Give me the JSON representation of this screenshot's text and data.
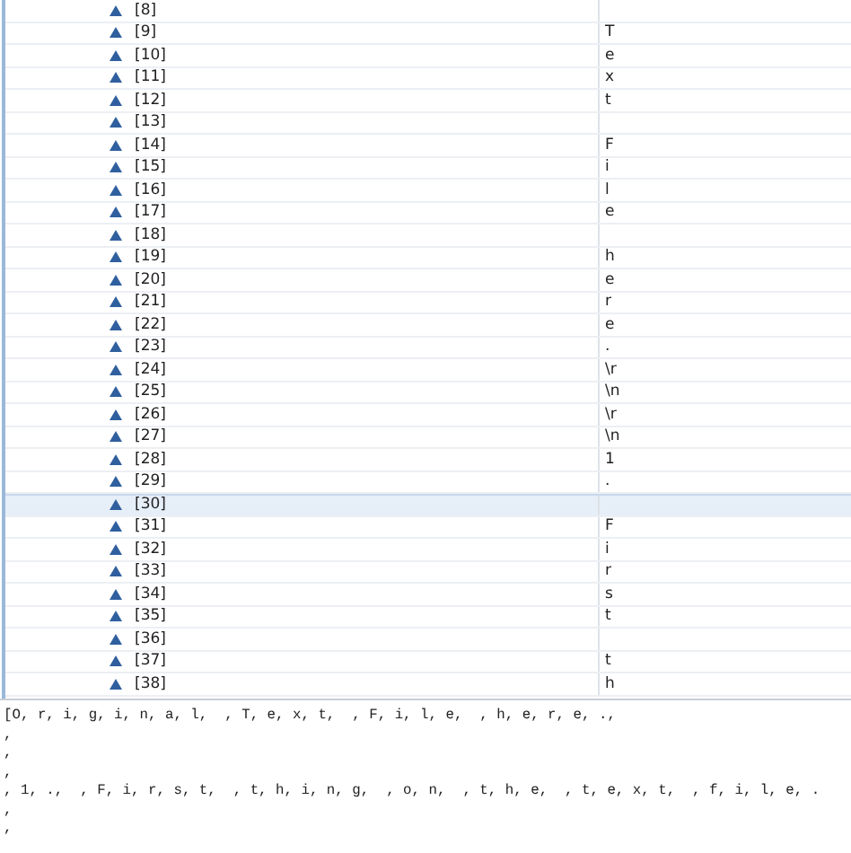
{
  "variables": [
    {
      "name": "[8]",
      "selected": false
    },
    {
      "name": "[9]",
      "value": "T",
      "selected": false
    },
    {
      "name": "[10]",
      "value": "e",
      "selected": false
    },
    {
      "name": "[11]",
      "value": "x",
      "selected": false
    },
    {
      "name": "[12]",
      "value": "t",
      "selected": false
    },
    {
      "name": "[13]",
      "selected": false
    },
    {
      "name": "[14]",
      "value": "F",
      "selected": false
    },
    {
      "name": "[15]",
      "value": "i",
      "selected": false
    },
    {
      "name": "[16]",
      "value": "l",
      "selected": false
    },
    {
      "name": "[17]",
      "value": "e",
      "selected": false
    },
    {
      "name": "[18]",
      "selected": false
    },
    {
      "name": "[19]",
      "value": "h",
      "selected": false
    },
    {
      "name": "[20]",
      "value": "e",
      "selected": false
    },
    {
      "name": "[21]",
      "value": "r",
      "selected": false
    },
    {
      "name": "[22]",
      "value": "e",
      "selected": false
    },
    {
      "name": "[23]",
      "value": ".",
      "selected": false
    },
    {
      "name": "[24]",
      "value": "\\r",
      "selected": false
    },
    {
      "name": "[25]",
      "value": "\\n",
      "selected": false
    },
    {
      "name": "[26]",
      "value": "\\r",
      "selected": false
    },
    {
      "name": "[27]",
      "value": "\\n",
      "selected": false
    },
    {
      "name": "[28]",
      "value": "1",
      "selected": false
    },
    {
      "name": "[29]",
      "value": ".",
      "selected": false
    },
    {
      "name": "[30]",
      "selected": true
    },
    {
      "name": "[31]",
      "value": "F",
      "selected": false
    },
    {
      "name": "[32]",
      "value": "i",
      "selected": false
    },
    {
      "name": "[33]",
      "value": "r",
      "selected": false
    },
    {
      "name": "[34]",
      "value": "s",
      "selected": false
    },
    {
      "name": "[35]",
      "value": "t",
      "selected": false
    },
    {
      "name": "[36]",
      "selected": false
    },
    {
      "name": "[37]",
      "value": "t",
      "selected": false
    },
    {
      "name": "[38]",
      "value": "h",
      "selected": false
    }
  ],
  "detail": {
    "lines": [
      "[O, r, i, g, i, n, a, l,  , T, e, x, t,  , F, i, l, e,  , h, e, r, e, .,",
      ",",
      ",",
      ",",
      ", 1, .,  , F, i, r, s, t,  , t, h, i, n, g,  , o, n,  , t, h, e,  , t, e, x, t,  , f, i, l, e, .",
      ",",
      ","
    ]
  }
}
